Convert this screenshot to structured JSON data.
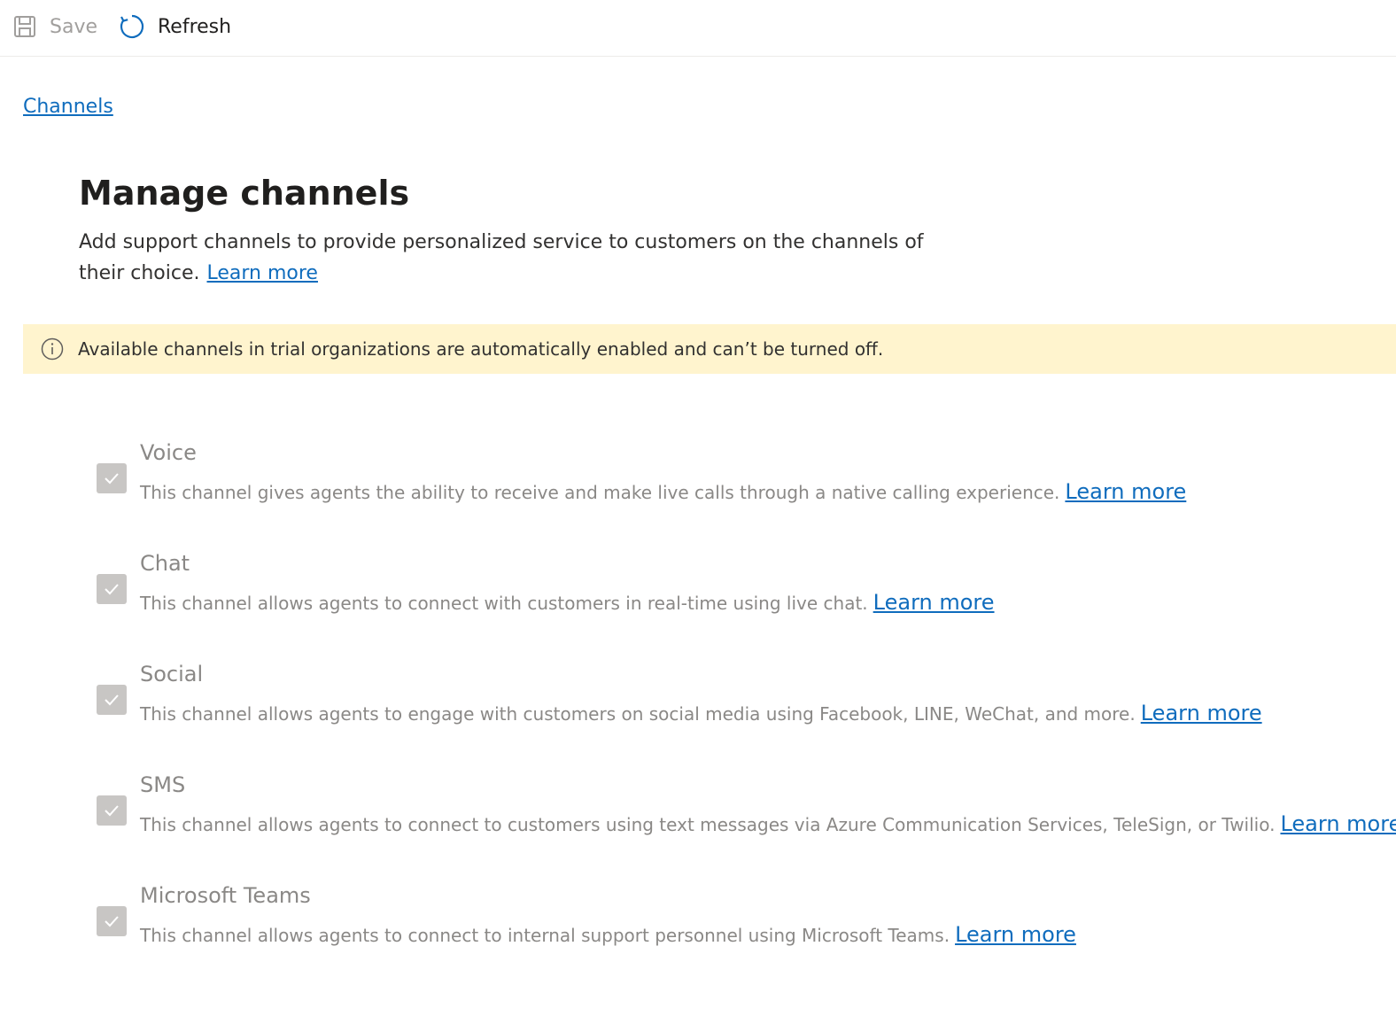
{
  "toolbar": {
    "save_label": "Save",
    "refresh_label": "Refresh"
  },
  "breadcrumb": {
    "label": "Channels"
  },
  "header": {
    "title": "Manage channels",
    "description": "Add support channels to provide personalized service to customers on the channels of their choice.",
    "learn_more": "Learn more"
  },
  "banner": {
    "message": "Available channels in trial organizations are automatically enabled and can’t be turned off."
  },
  "channels": [
    {
      "name": "Voice",
      "description": "This channel gives agents the ability to receive and make live calls through a native calling experience.",
      "link": "Learn more",
      "checked": true,
      "disabled": true
    },
    {
      "name": "Chat",
      "description": "This channel allows agents to connect with customers in real-time using live chat.",
      "link": "Learn more",
      "checked": true,
      "disabled": true
    },
    {
      "name": "Social",
      "description": "This channel allows agents to engage with customers on social media using Facebook, LINE, WeChat, and more.",
      "link": "Learn more",
      "checked": true,
      "disabled": true
    },
    {
      "name": "SMS",
      "description": "This channel allows agents to connect to customers using text messages via Azure Communication Services, TeleSign, or Twilio.",
      "link": "Learn more",
      "checked": true,
      "disabled": true
    },
    {
      "name": "Microsoft Teams",
      "description": "This channel allows agents to connect to internal support personnel using Microsoft Teams.",
      "link": "Learn more",
      "checked": true,
      "disabled": true
    }
  ],
  "colors": {
    "link": "#0f6cbd",
    "banner_bg": "#fff4ce",
    "disabled_text": "#8a8886",
    "disabled_checkbox": "#c8c6c4"
  },
  "icons": {
    "save": "save-icon",
    "refresh": "refresh-icon",
    "info": "info-icon",
    "checkmark": "checkmark-icon"
  }
}
